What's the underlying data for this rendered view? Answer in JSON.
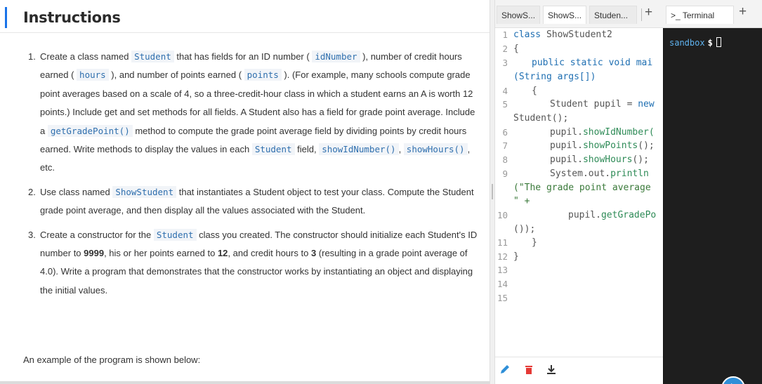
{
  "instructions": {
    "title": "Instructions",
    "item1": {
      "num": "1.",
      "t1": "Create a class named ",
      "c1": "Student",
      "t2": " that has fields for an ID number ( ",
      "c2": "idNumber",
      "t3": " ), number of credit hours earned ( ",
      "c3": "hours",
      "t4": " ), and number of points earned ( ",
      "c4": "points",
      "t5": " ). (For example, many schools compute grade point averages based on a scale of 4, so a three-credit-hour class in which a student earns an A is worth 12 points.) Include get and set methods for all fields. A Student also has a field for grade point average. Include a ",
      "c5": "getGradePoint()",
      "t6": " method to compute the grade point average field by dividing points by credit hours earned. Write methods to display the values in each ",
      "c6": "Student",
      "t7": " field, ",
      "c7": "showIdNumber()",
      "t8": ", ",
      "c8": "showHours()",
      "t9": ", etc."
    },
    "item2": {
      "num": "2.",
      "t1": "Use class named ",
      "c1": "ShowStudent",
      "t2": " that instantiates a Student object to test your class. Compute the Student grade point average, and then display all the values associated with the Student."
    },
    "item3": {
      "num": "3.",
      "t1": "Create a constructor for the ",
      "c1": "Student",
      "t2": " class you created. The constructor should initialize each Student's ID number to ",
      "b1": "9999",
      "t3": ", his or her points earned to ",
      "b2": "12",
      "t4": ", and credit hours to ",
      "b3": "3",
      "t5": " (resulting in a grade point average of 4.0). Write a program that demonstrates that the constructor works by instantiating an object and displaying the initial values."
    },
    "example": "An example of the program is shown below:"
  },
  "editor": {
    "tabs": [
      "ShowS...",
      "ShowS...",
      "Studen..."
    ],
    "active_tab": 1,
    "add_tab": "+",
    "line_numbers": [
      "1",
      "2",
      "3",
      "4",
      "5",
      "6",
      "7",
      "8",
      "9",
      "10",
      "11",
      "12",
      "13",
      "14",
      "15"
    ],
    "code": {
      "l1a": "class",
      "l1b": " ShowStudent2",
      "l2": "{",
      "l3a": "public static void mai",
      "l3b": "(String args[])",
      "l4": "{",
      "l5a": "Student pupil = ",
      "l5b": "new",
      "l5c": "Student();",
      "l6a": "pupil.",
      "l6b": "showIdNumber(",
      "l7a": "pupil.",
      "l7b": "showPoints",
      "l7c": "();",
      "l8a": "pupil.",
      "l8b": "showHours",
      "l8c": "();",
      "l9a": "System.out.",
      "l9b": "println",
      "l9c": "(\"The grade point average",
      "l9d": "\" +",
      "l10a": "pupil.",
      "l10b": "getGradePo",
      "l10c": "());",
      "l11": "}",
      "l12": "}"
    }
  },
  "terminal": {
    "tab_label": "Terminal",
    "tab_prefix": ">_",
    "add_tab": "+",
    "prompt_dir": "sandbox",
    "prompt_symbol": "$"
  },
  "colors": {
    "accent": "#1a73e8",
    "code_keyword": "#1f6fb2",
    "terminal_bg": "#1e1e1e",
    "run_button": "#2f8fd8"
  }
}
